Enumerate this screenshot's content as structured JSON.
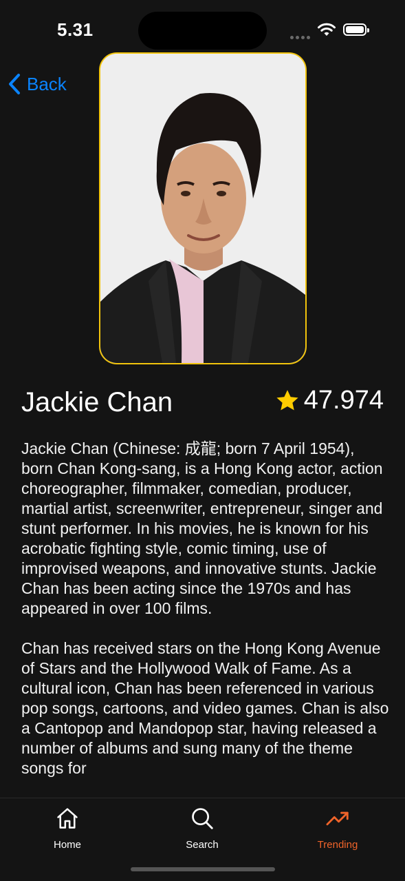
{
  "status_bar": {
    "time": "5.31"
  },
  "nav": {
    "back_label": "Back"
  },
  "person": {
    "name": "Jackie Chan",
    "popularity": "47.974",
    "photo_alt": "Jackie Chan portrait",
    "bio_paragraphs": [
      "Jackie Chan (Chinese: 成龍; born 7 April 1954), born Chan Kong-sang, is a Hong Kong actor, action choreographer, filmmaker, comedian, producer, martial artist, screenwriter, entrepreneur, singer and stunt performer. In his movies, he is known for his acrobatic fighting style, comic timing, use of improvised weapons, and innovative stunts. Jackie Chan has been acting since the 1970s and has appeared in over 100 films.",
      "Chan has received stars on the Hong Kong Avenue of Stars and the Hollywood Walk of Fame. As a cultural icon, Chan has been referenced in various pop songs, cartoons, and video games. Chan is also a Cantopop and Mandopop star, having released a number of albums and sung many of the theme songs for"
    ]
  },
  "tabs": [
    {
      "label": "Home",
      "icon": "house-icon"
    },
    {
      "label": "Search",
      "icon": "magnifier-icon"
    },
    {
      "label": "Trending",
      "icon": "trending-icon",
      "active": true
    }
  ],
  "colors": {
    "accent": "#0a84ff",
    "frame": "#f2c40c",
    "star": "#ffcc00",
    "active_tab": "#f0642a",
    "background": "#141414"
  }
}
